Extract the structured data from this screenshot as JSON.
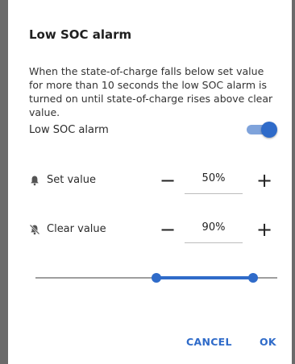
{
  "dialog": {
    "title": "Low SOC alarm",
    "description": "When the state-of-charge falls below set value for more than 10 seconds the low SOC alarm is turned on until state-of-charge rises above clear value."
  },
  "alarm_toggle": {
    "label": "Low SOC alarm",
    "enabled": true
  },
  "set_value": {
    "label": "Set value",
    "value": "50%",
    "icon": "bell-icon",
    "minus": "−",
    "plus": "+"
  },
  "clear_value": {
    "label": "Clear value",
    "value": "90%",
    "icon": "bell-off-icon",
    "minus": "−",
    "plus": "+"
  },
  "range_slider": {
    "low": 0.5,
    "high": 0.9
  },
  "actions": {
    "cancel": "CANCEL",
    "ok": "OK"
  },
  "colors": {
    "accent": "#2f6bc9",
    "track_light": "#7fa3db",
    "scrim": "#6b6b6b"
  }
}
